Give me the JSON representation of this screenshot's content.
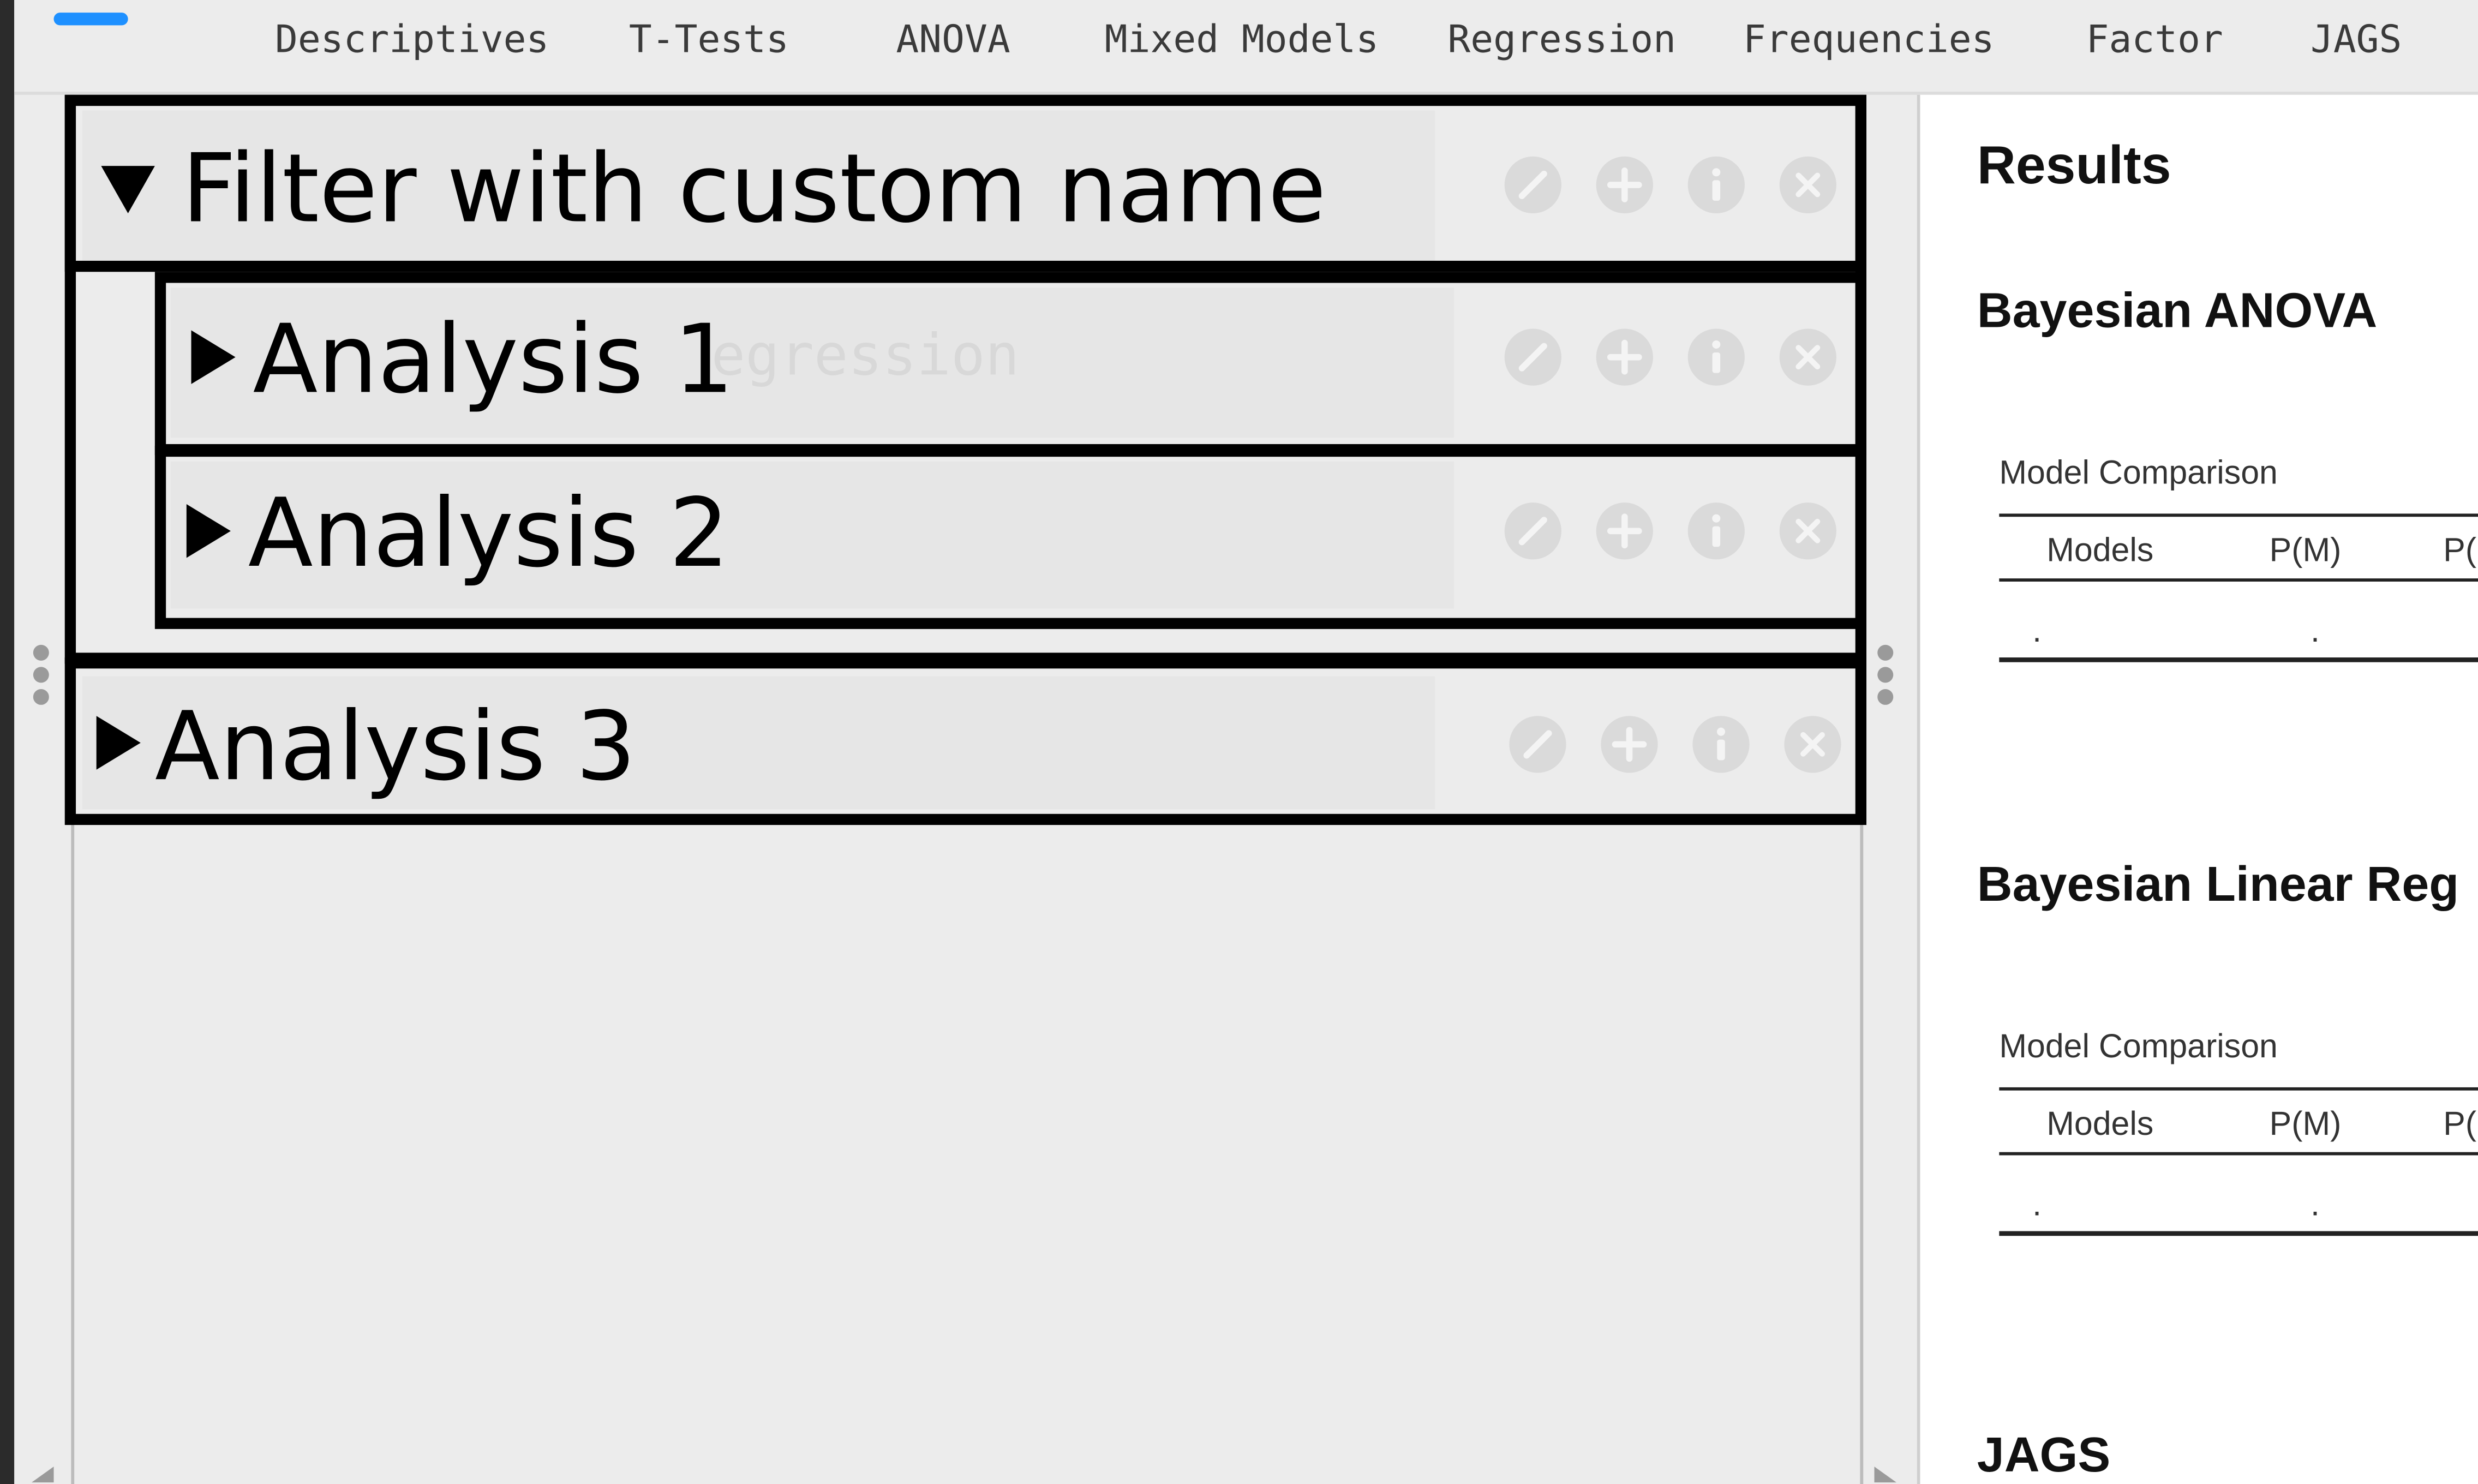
{
  "ribbon": {
    "tabs": [
      {
        "label": "Descriptives"
      },
      {
        "label": "T-Tests"
      },
      {
        "label": "ANOVA"
      },
      {
        "label": "Mixed Models"
      },
      {
        "label": "Regression"
      },
      {
        "label": "Frequencies"
      },
      {
        "label": "Factor"
      },
      {
        "label": "JAGS"
      }
    ]
  },
  "analyses": {
    "filter": {
      "title": "Filter with custom name",
      "expanded": true
    },
    "items": [
      {
        "title": "Analysis 1",
        "ghost_text": "egression",
        "expanded": false
      },
      {
        "title": "Analysis 2",
        "expanded": false
      },
      {
        "title": "Analysis 3",
        "expanded": false
      }
    ],
    "controls": [
      "pencil-icon",
      "plus-circle-icon",
      "info-icon",
      "close-circle-icon"
    ]
  },
  "results": {
    "heading": "Results",
    "sections": [
      {
        "title": "Bayesian ANOVA",
        "caption": "Model Comparison",
        "columns": [
          "Models",
          "P(M)",
          "P("
        ],
        "row": [
          ".",
          "."
        ]
      },
      {
        "title": "Bayesian Linear Reg",
        "caption": "Model Comparison",
        "columns": [
          "Models",
          "P(M)",
          "P("
        ],
        "row": [
          ".",
          "."
        ]
      },
      {
        "title": "JAGS"
      }
    ]
  },
  "colors": {
    "accent": "#1e90ff",
    "outline": "#000000",
    "pane_bg": "#ececec",
    "results_bg": "#ffffff"
  }
}
